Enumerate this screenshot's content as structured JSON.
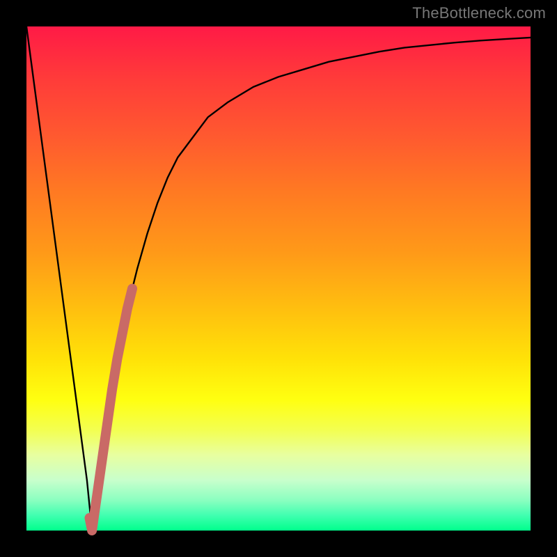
{
  "watermark": "TheBottleneck.com",
  "colors": {
    "background": "#000000",
    "curve_main": "#000000",
    "curve_overlay": "#c96a66",
    "watermark_text": "#777777"
  },
  "chart_data": {
    "type": "line",
    "title": "",
    "xlabel": "",
    "ylabel": "",
    "xlim": [
      0,
      100
    ],
    "ylim": [
      0,
      100
    ],
    "series": [
      {
        "name": "bottleneck-curve",
        "x": [
          0,
          2,
          4,
          6,
          8,
          10,
          12,
          13,
          14,
          16,
          18,
          20,
          22,
          24,
          26,
          28,
          30,
          33,
          36,
          40,
          45,
          50,
          55,
          60,
          65,
          70,
          75,
          80,
          85,
          90,
          95,
          100
        ],
        "values": [
          100,
          85,
          70,
          55,
          40,
          25,
          10,
          0,
          7,
          21,
          34,
          44,
          52,
          59,
          65,
          70,
          74,
          78,
          82,
          85,
          88,
          90,
          91.5,
          93,
          94,
          95,
          95.8,
          96.3,
          96.8,
          97.2,
          97.5,
          97.8
        ]
      },
      {
        "name": "highlight-segment",
        "x": [
          12.5,
          13,
          14,
          15,
          16,
          17,
          18,
          19,
          20,
          21
        ],
        "values": [
          2.5,
          0,
          7,
          14,
          21,
          28,
          34,
          39,
          44,
          48
        ]
      }
    ],
    "annotations": []
  }
}
